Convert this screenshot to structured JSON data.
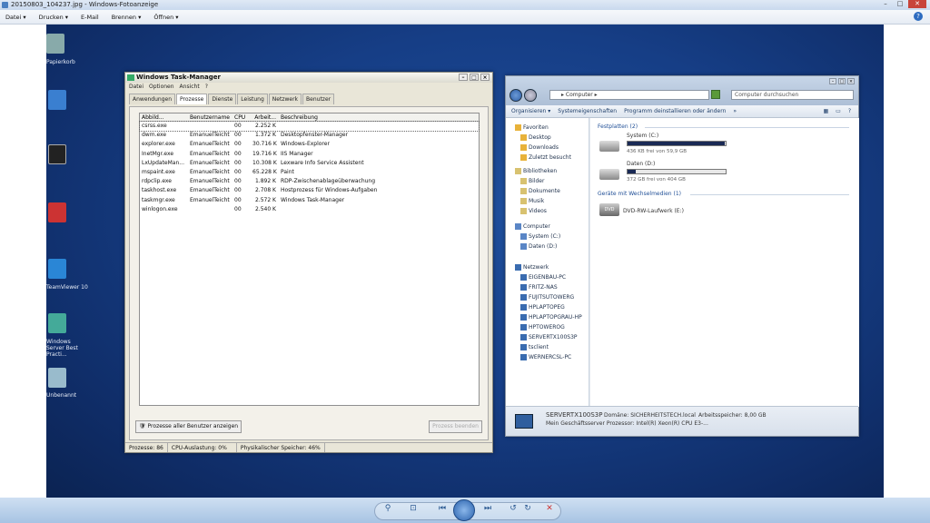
{
  "window": {
    "title": "20150803_104237.jpg - Windows-Fotoanzeige"
  },
  "menu": [
    "Datei ▾",
    "Drucken ▾",
    "E-Mail",
    "Brennen ▾",
    "Öffnen ▾"
  ],
  "desktop": [
    "Papierkorb",
    "TeamViewer 10",
    "Windows Server Best Practi...",
    "Unbenannt"
  ],
  "taskmanager": {
    "title": "Windows Task-Manager",
    "menu": [
      "Datei",
      "Optionen",
      "Ansicht",
      "?"
    ],
    "tabs": [
      "Anwendungen",
      "Prozesse",
      "Dienste",
      "Leistung",
      "Netzwerk",
      "Benutzer"
    ],
    "columns": [
      "Abbild...",
      "Benutzername",
      "CPU",
      "Arbeit...",
      "Beschreibung"
    ],
    "rows": [
      [
        "csrss.exe",
        "",
        "00",
        "2.252 K",
        ""
      ],
      [
        "dwm.exe",
        "EmanuelTeicht",
        "00",
        "1.372 K",
        "Desktopfenster-Manager"
      ],
      [
        "explorer.exe",
        "EmanuelTeicht",
        "00",
        "30.716 K",
        "Windows-Explorer"
      ],
      [
        "InetMgr.exe",
        "EmanuelTeicht",
        "00",
        "19.716 K",
        "IIS Manager"
      ],
      [
        "LxUpdateMan...",
        "EmanuelTeicht",
        "00",
        "10.308 K",
        "Lexware Info Service Assistent"
      ],
      [
        "mspaint.exe",
        "EmanuelTeicht",
        "00",
        "65.228 K",
        "Paint"
      ],
      [
        "rdpclip.exe",
        "EmanuelTeicht",
        "00",
        "1.892 K",
        "RDP-Zwischenablageüberwachung"
      ],
      [
        "taskhost.exe",
        "EmanuelTeicht",
        "00",
        "2.708 K",
        "Hostprozess für Windows-Aufgaben"
      ],
      [
        "taskmgr.exe",
        "EmanuelTeicht",
        "00",
        "2.572 K",
        "Windows Task-Manager"
      ],
      [
        "winlogon.exe",
        "",
        "00",
        "2.540 K",
        ""
      ]
    ],
    "show_all_button": "Prozesse aller Benutzer anzeigen",
    "end_button": "Prozess beenden",
    "status": [
      "Prozesse: 86",
      "CPU-Auslastung: 0%",
      "Physikalischer Speicher: 46%"
    ]
  },
  "explorer": {
    "address": "▸ Computer ▸",
    "search_placeholder": "Computer durchsuchen",
    "commands": [
      "Organisieren ▾",
      "Systemeigenschaften",
      "Programm deinstallieren oder ändern",
      "»"
    ],
    "favorites": [
      "Favoriten",
      "Desktop",
      "Downloads",
      "Zuletzt besucht"
    ],
    "libraries": [
      "Bibliotheken",
      "Bilder",
      "Dokumente",
      "Musik",
      "Videos"
    ],
    "computer": [
      "Computer",
      "System (C:)",
      "Daten (D:)"
    ],
    "network": [
      "Netzwerk",
      "EIGENBAU-PC",
      "FRITZ-NAS",
      "FUJITSUTOWERG",
      "HPLAPTOPEG",
      "HPLAPTOPGRAU-HP",
      "HPTOWEROG",
      "SERVERTX100S3P",
      "tsclient",
      "WERNERCSL-PC"
    ],
    "group_hdd": "Festplatten (2)",
    "drives": [
      {
        "name": "System (C:)",
        "free": "436 KB frei von 59,9 GB",
        "used_fraction": 0.99
      },
      {
        "name": "Daten (D:)",
        "free": "372 GB frei von 404 GB",
        "used_fraction": 0.08
      }
    ],
    "group_removable": "Geräte mit Wechselmedien (1)",
    "dvd": "DVD-RW-Laufwerk (E:)",
    "details": {
      "name": "SERVERTX100S3P",
      "domain": "Domäne: SICHERHEITSTECH.local",
      "memory": "Arbeitsspeicher: 8,00 GB",
      "processor": "Mein Geschäftsserver Prozessor: Intel(R) Xeon(R) CPU E3-..."
    }
  }
}
